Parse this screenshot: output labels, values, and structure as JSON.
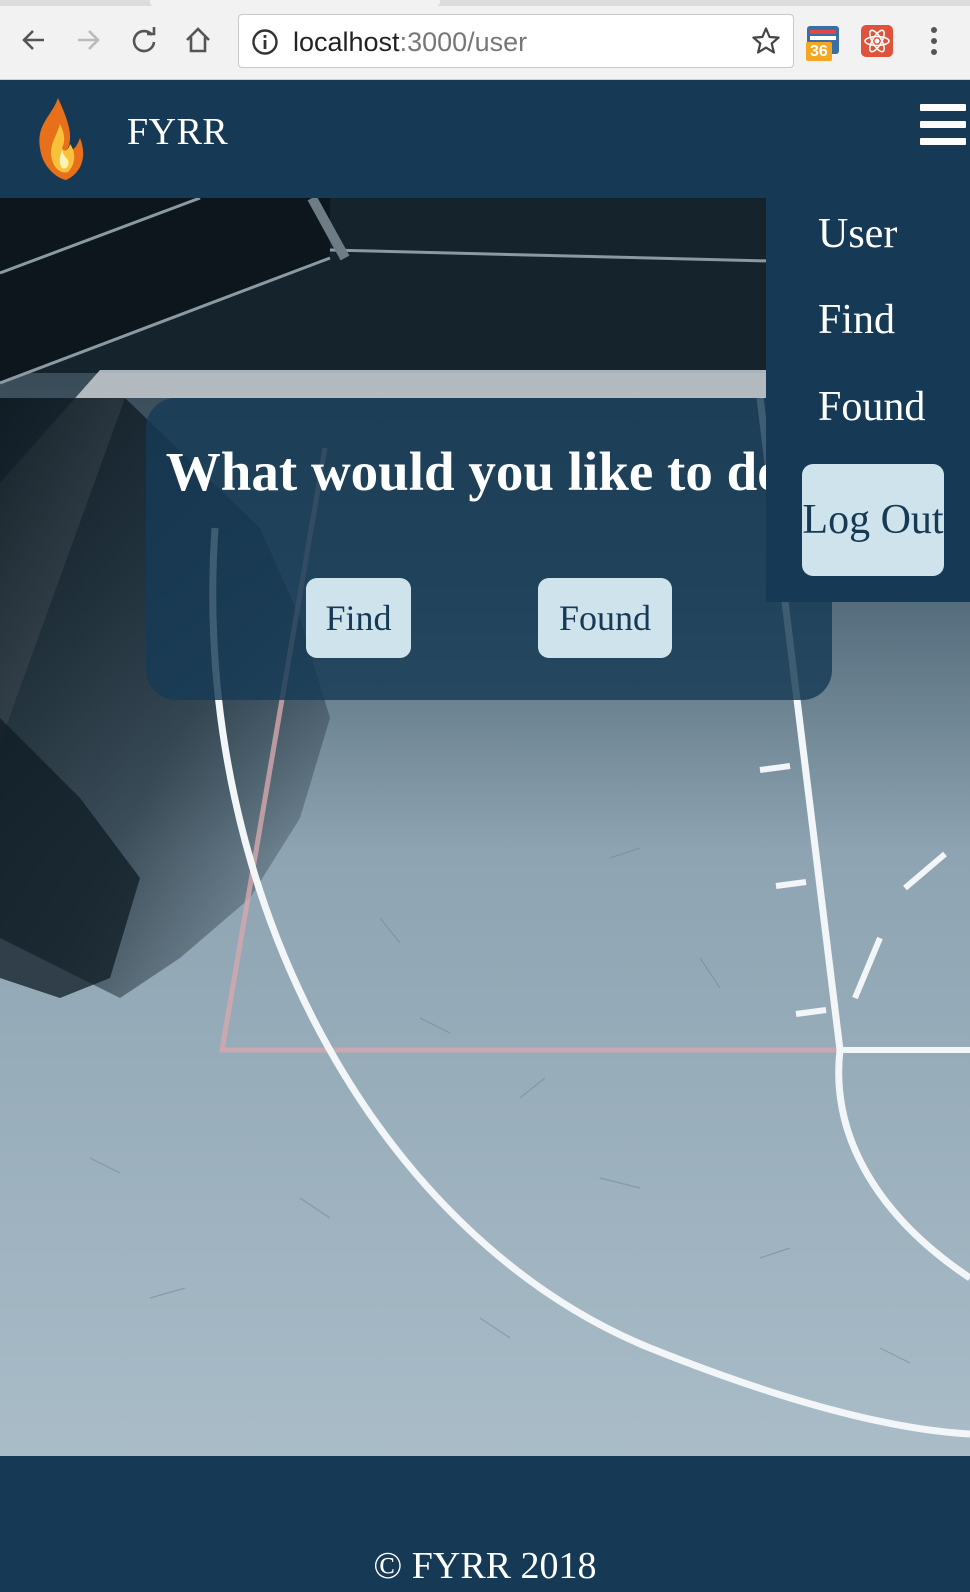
{
  "browser": {
    "url_host": "localhost",
    "url_path": ":3000/user",
    "extension_badge": "36"
  },
  "navbar": {
    "brand": "FYRR",
    "logo_icon": "fire-icon",
    "menu_icon": "hamburger-icon"
  },
  "card": {
    "title": "What would you like to do?",
    "find_label": "Find",
    "found_label": "Found"
  },
  "dropdown": {
    "items": [
      "User",
      "Find",
      "Found"
    ],
    "logout_label": "Log Out"
  },
  "footer": {
    "text": "© FYRR 2018"
  },
  "colors": {
    "primary": "#163a55",
    "button_bg": "#cfe3ec",
    "text_light": "#ffffff"
  }
}
